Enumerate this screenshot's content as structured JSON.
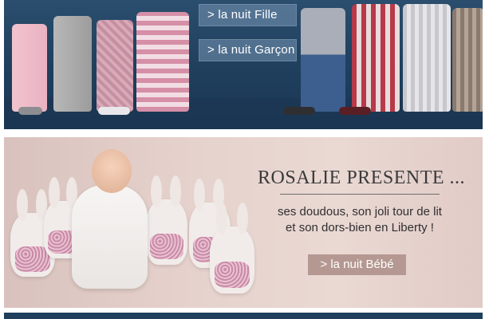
{
  "top_banner": {
    "btn_fille": "> la nuit Fille",
    "btn_garcon": "> la nuit Garçon"
  },
  "middle_banner": {
    "headline": "ROSALIE PRESENTE ...",
    "desc_line1": "ses doudous, son joli tour de lit",
    "desc_line2": "et son dors-bien en Liberty !",
    "btn_bebe": "> la nuit Bébé"
  },
  "colors": {
    "banner_top_bg": "#1f3f5d",
    "banner_mid_bg": "#e6d2cd",
    "button_bebe_bg": "#b49891"
  }
}
